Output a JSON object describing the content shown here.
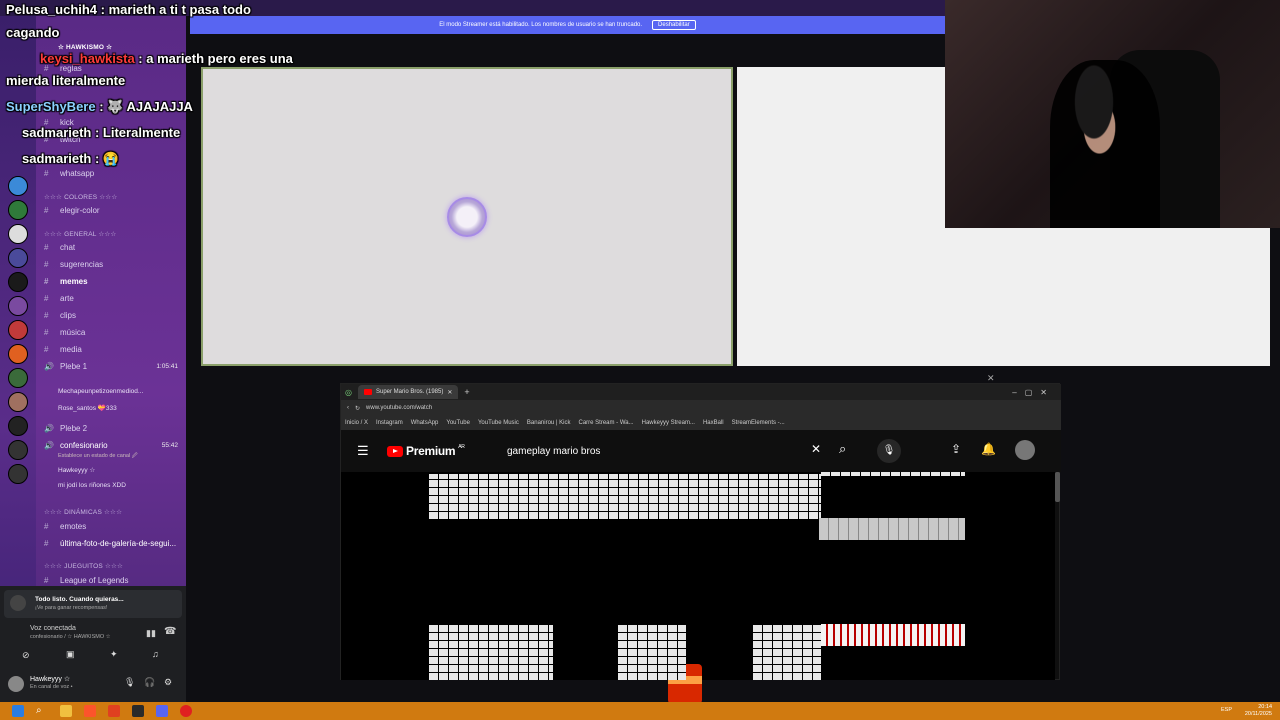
{
  "streamer_bar": {
    "message": "El modo Streamer está habilitado. Los nombres de usuario se han truncado.",
    "button": "Deshabilitar"
  },
  "server": {
    "name": "☆ HAWKISMO ☆"
  },
  "channels": {
    "top": [
      "reglas",
      "kick",
      "twitch",
      "whatsapp"
    ],
    "colores_cat": "☆☆☆ COLORES ☆☆☆",
    "colores": [
      "elegir-color"
    ],
    "general_cat": "☆☆☆ GENERAL ☆☆☆",
    "general": [
      "chat",
      "sugerencias",
      "memes",
      "arte",
      "clips",
      "música",
      "media"
    ],
    "voice1": {
      "name": "Plebe 1",
      "time": "1:05:41"
    },
    "voice1_users": [
      "Mechapeunpetizoenmediod...",
      "Rose_santos 💝333"
    ],
    "voice2": "Plebe 2",
    "voice3": {
      "name": "confesionario",
      "time": "55:42",
      "status": "Establece un estado de canal 🖉"
    },
    "voice3_users": [
      "Hawkeyyy ☆",
      "mi jodí los riñones XDD"
    ],
    "dinamicas_cat": "☆☆☆ DINÁMICAS ☆☆☆",
    "dinamicas": [
      "emotes",
      "última-foto-de-galería-de-segui..."
    ],
    "juegos_cat": "☆☆☆ JUEGUITOS ☆☆☆",
    "juegos": [
      "League of Legends"
    ]
  },
  "notice": {
    "title": "Todo listo. Cuando quieras...",
    "sub": "¡Ve para ganar recompensas!"
  },
  "voice_connected": {
    "label": "Voz conectada",
    "channel": "confesionario / ☆ HAWKISMO ☆"
  },
  "user": {
    "name": "Hawkeyyy ☆",
    "status": "En canal de voz •"
  },
  "chat": [
    {
      "user": "Pelusa_uchih4",
      "text": " : marieth a ti t pasa todo"
    },
    {
      "user": "",
      "text": "cagando"
    },
    {
      "user": "keysi_hawkista",
      "text": " : a marieth pero eres una"
    },
    {
      "user": "",
      "text": "mierda literalmente"
    },
    {
      "user": "SuperShyBere",
      "text": " : 🐺 AJAJAJJA"
    },
    {
      "user": "sadmarieth",
      "text": " : Literalmente"
    },
    {
      "user": "sadmarieth",
      "text": " : 😭"
    }
  ],
  "browser": {
    "tab_title": "Super Mario Bros. (1985)",
    "url": "www.youtube.com/watch",
    "bookmarks": [
      "Inicio / X",
      "Instagram",
      "WhatsApp",
      "YouTube",
      "YouTube Music",
      "Bananirou | Kick",
      "Carre Stream - Wa...",
      "Hawkeyyy Stream...",
      "HaxBall",
      "StreamElements -..."
    ],
    "logo": "Premium",
    "logo_region": "AR",
    "search": "gameplay mario bros"
  },
  "clock": {
    "time": "20:14",
    "date": "20/11/2025",
    "lang": "ESP"
  },
  "colors": {
    "streamer_bar": "#5865f2",
    "taskbar": "#d07a10",
    "channel_bg": "#6b3296"
  }
}
